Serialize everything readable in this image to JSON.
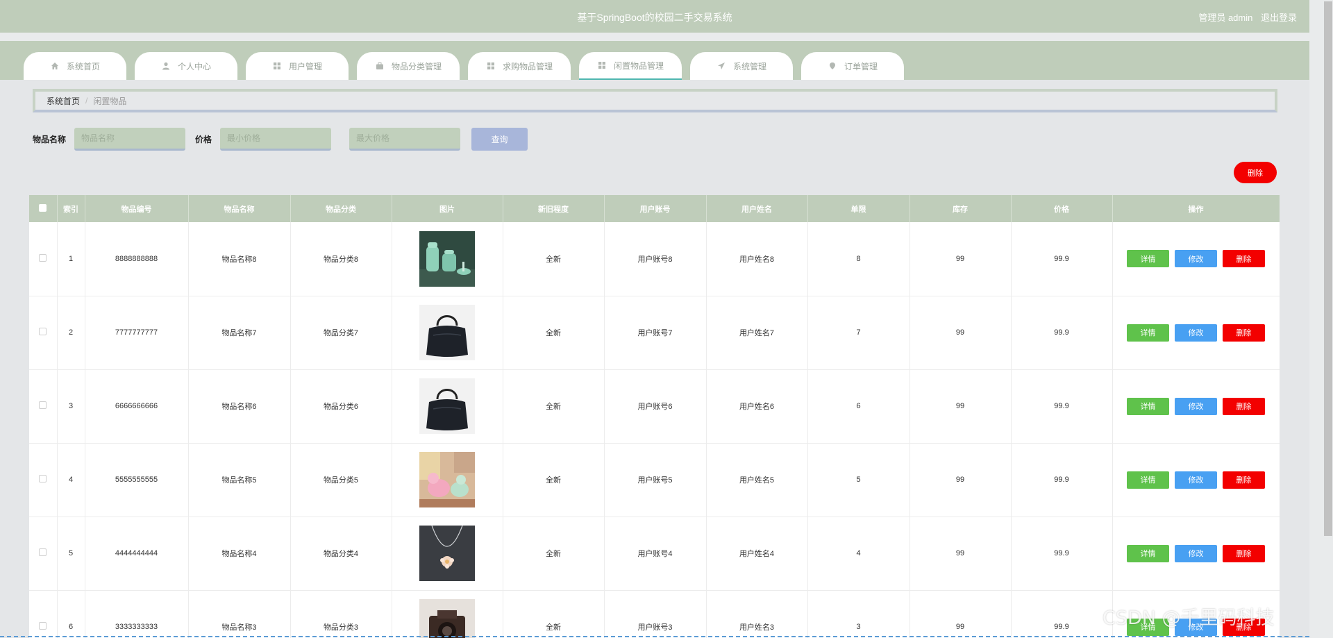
{
  "header": {
    "title": "基于SpringBoot的校园二手交易系统",
    "user_label": "管理员 admin",
    "logout_label": "退出登录"
  },
  "nav": {
    "tabs": [
      {
        "label": "系统首页",
        "icon": "home-icon"
      },
      {
        "label": "个人中心",
        "icon": "user-icon"
      },
      {
        "label": "用户管理",
        "icon": "grid-icon"
      },
      {
        "label": "物品分类管理",
        "icon": "briefcase-icon"
      },
      {
        "label": "求购物品管理",
        "icon": "grid-icon"
      },
      {
        "label": "闲置物品管理",
        "icon": "grid-icon"
      },
      {
        "label": "系统管理",
        "icon": "send-icon"
      },
      {
        "label": "订单管理",
        "icon": "pin-icon"
      }
    ],
    "active_index": 5
  },
  "breadcrumb": {
    "home": "系统首页",
    "separator": "/",
    "current": "闲置物品"
  },
  "search": {
    "name_label": "物品名称",
    "name_placeholder": "物品名称",
    "price_label": "价格",
    "price_min_placeholder": "最小价格",
    "price_max_placeholder": "最大价格",
    "query_label": "查询"
  },
  "actions": {
    "delete_label": "删除"
  },
  "table": {
    "headers": [
      "索引",
      "物品编号",
      "物品名称",
      "物品分类",
      "图片",
      "新旧程度",
      "用户账号",
      "用户姓名",
      "单限",
      "库存",
      "价格",
      "操作"
    ],
    "rows": [
      {
        "index": "1",
        "code": "8888888888",
        "name": "物品名称8",
        "category": "物品分类8",
        "image": "teapot-set",
        "condition": "全新",
        "account": "用户账号8",
        "username": "用户姓名8",
        "limit": "8",
        "stock": "99",
        "price": "99.9"
      },
      {
        "index": "2",
        "code": "7777777777",
        "name": "物品名称7",
        "category": "物品分类7",
        "image": "black-handbag",
        "condition": "全新",
        "account": "用户账号7",
        "username": "用户姓名7",
        "limit": "7",
        "stock": "99",
        "price": "99.9"
      },
      {
        "index": "3",
        "code": "6666666666",
        "name": "物品名称6",
        "category": "物品分类6",
        "image": "black-handbag",
        "condition": "全新",
        "account": "用户账号6",
        "username": "用户姓名6",
        "limit": "6",
        "stock": "99",
        "price": "99.9"
      },
      {
        "index": "4",
        "code": "5555555555",
        "name": "物品名称5",
        "category": "物品分类5",
        "image": "toy-figures",
        "condition": "全新",
        "account": "用户账号5",
        "username": "用户姓名5",
        "limit": "5",
        "stock": "99",
        "price": "99.9"
      },
      {
        "index": "5",
        "code": "4444444444",
        "name": "物品名称4",
        "category": "物品分类4",
        "image": "necklace",
        "condition": "全新",
        "account": "用户账号4",
        "username": "用户姓名4",
        "limit": "4",
        "stock": "99",
        "price": "99.9"
      },
      {
        "index": "6",
        "code": "3333333333",
        "name": "物品名称3",
        "category": "物品分类3",
        "image": "camera",
        "condition": "全新",
        "account": "用户账号3",
        "username": "用户姓名3",
        "limit": "3",
        "stock": "99",
        "price": "99.9"
      }
    ],
    "op_labels": {
      "detail": "详情",
      "edit": "修改",
      "delete": "删除"
    }
  },
  "watermark": "CSDN @千里码科技",
  "colors": {
    "theme": "#bfcdba",
    "detail": "#5fc24b",
    "edit": "#48a0f2",
    "delete": "#f30000",
    "query": "#a8b6da"
  }
}
